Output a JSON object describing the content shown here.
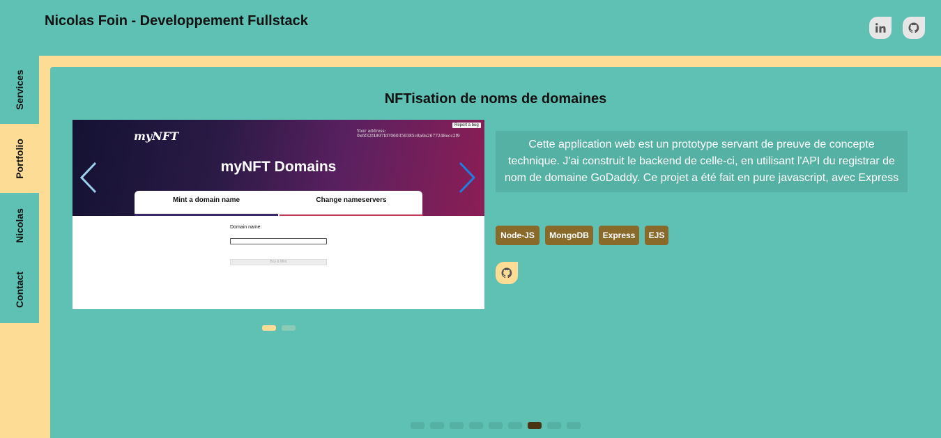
{
  "header": {
    "title": "Nicolas Foin - Developpement Fullstack",
    "social": [
      {
        "name": "linkedin",
        "icon": "linkedin-icon"
      },
      {
        "name": "github",
        "icon": "github-icon"
      }
    ]
  },
  "sidebar": {
    "items": [
      {
        "label": "Services",
        "active": false
      },
      {
        "label": "Portfolio",
        "active": true
      },
      {
        "label": "Nicolas",
        "active": false
      },
      {
        "label": "Contact",
        "active": false
      }
    ]
  },
  "project": {
    "title": "NFTisation de noms de domaines",
    "description": "Cette application web est un prototype servant de preuve de concepte technique. J'ai construit le backend de celle-ci, en utilisant l'API du registrar de nom de domaine GoDaddy. Ce projet a été fait en pure javascript, avec Express",
    "tags": [
      "Node-JS",
      "MongoDB",
      "Express",
      "EJS"
    ],
    "carousel": {
      "slide_count": 2,
      "active_slide": 1,
      "screenshot": {
        "logo": "myNFT",
        "report_button": "Report a bug",
        "address": "Your address: 0x6f32f4897fd7060359385c8a9a2677248ecc2f9",
        "heading": "myNFT Domains",
        "tabs": [
          "Mint a domain name",
          "Change nameservers"
        ],
        "field_label": "Domain name:",
        "button_label": "Buy & Mint"
      }
    }
  },
  "pagination": {
    "count": 9,
    "active_index": 7
  },
  "colors": {
    "teal": "#5fc1b3",
    "yellow": "#fddd96",
    "tag_brown": "#896a2b",
    "active_dot": "#4a3512"
  }
}
